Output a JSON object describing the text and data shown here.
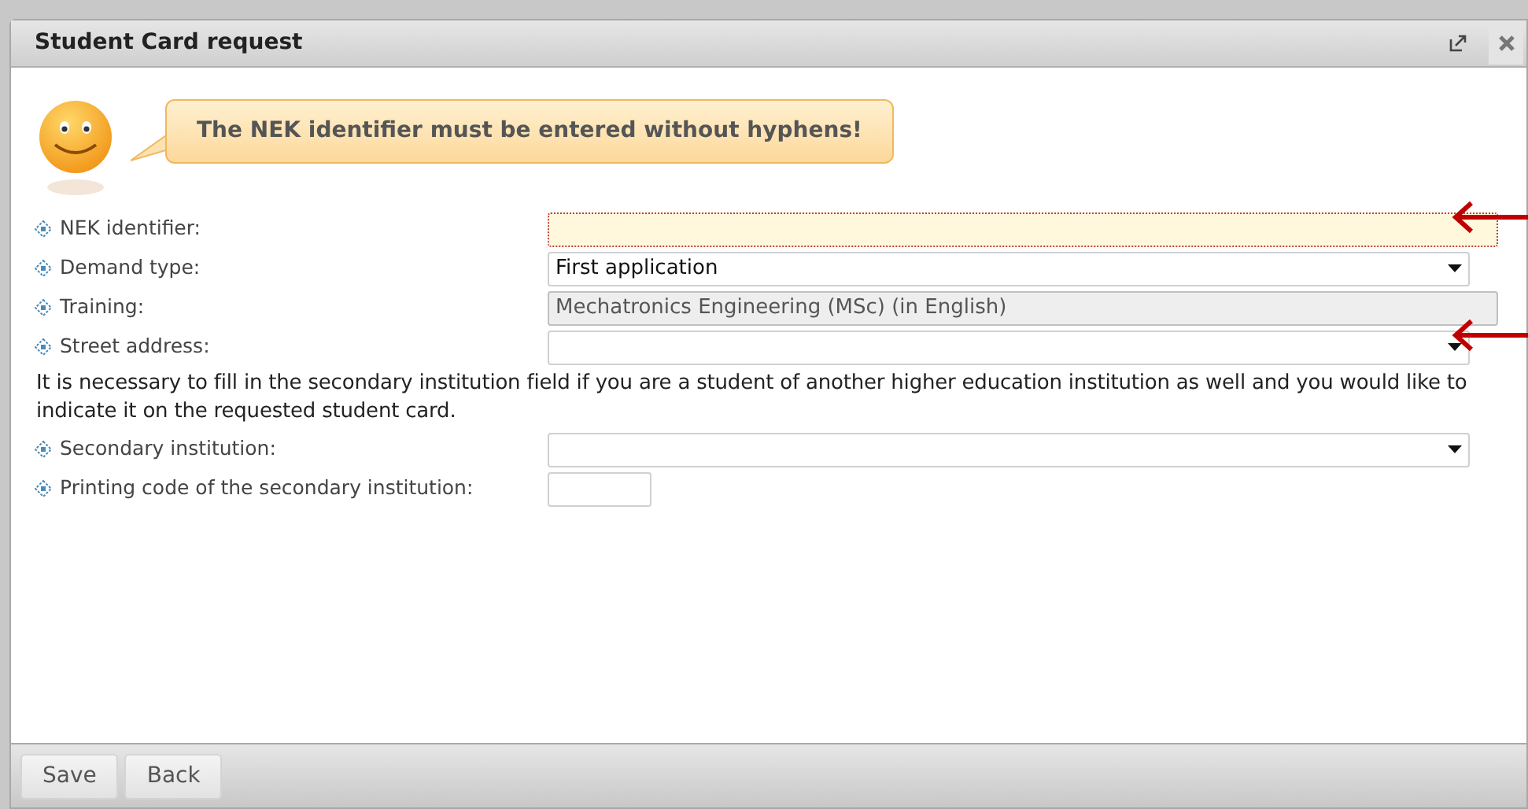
{
  "window": {
    "title": "Student Card request"
  },
  "message": "The NEK identifier must be entered without hyphens!",
  "fields": [
    {
      "kind": "text",
      "label": "NEK identifier:",
      "highlighted": true,
      "arrow": true
    },
    {
      "kind": "select",
      "label": "Demand type:",
      "value": "First application",
      "highlighted": false,
      "arrow": false
    },
    {
      "kind": "readonly",
      "label": "Training:",
      "value": "Mechatronics Engineering (MSc) (in English)",
      "highlighted": false,
      "arrow": false
    },
    {
      "kind": "select",
      "label": "Street address:",
      "highlighted": false,
      "arrow": true
    },
    {
      "kind": "note",
      "text": "It is necessary to fill in the secondary institution field if you are a student of another higher education institution as well and you would like to indicate it on the requested student card."
    },
    {
      "kind": "select",
      "label": "Secondary institution:",
      "highlighted": false,
      "arrow": false
    },
    {
      "kind": "short",
      "label": "Printing code of the secondary institution:",
      "highlighted": false,
      "arrow": false
    }
  ],
  "buttons": [
    "Save",
    "Back"
  ]
}
